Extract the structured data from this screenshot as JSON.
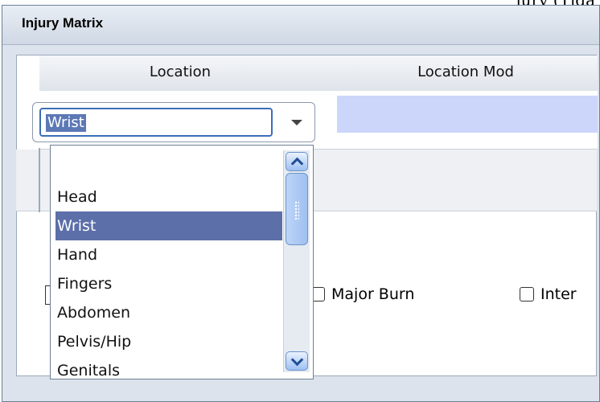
{
  "window": {
    "title": "Injury Matrix",
    "top_clip_text": "jury (Tiga"
  },
  "table": {
    "columns": [
      "Location",
      "Location Mod"
    ]
  },
  "location_combo": {
    "value": "Wrist"
  },
  "dropdown": {
    "options": [
      "",
      "Head",
      "Wrist",
      "Hand",
      "Fingers",
      "Abdomen",
      "Pelvis/Hip",
      "Genitals"
    ],
    "selected": "Wrist"
  },
  "checkboxes": {
    "major_burn": "Major Burn",
    "internal": "Inter"
  },
  "colors": {
    "selection": "#5c6fa9",
    "location_mod_cell": "#ccd6fb",
    "titlebar": "#dce3ec"
  }
}
